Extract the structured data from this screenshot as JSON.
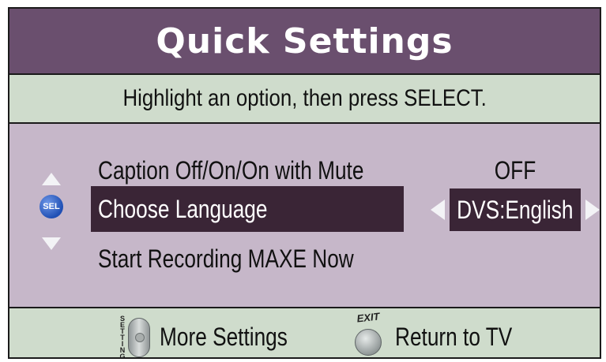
{
  "header": {
    "title": "Quick Settings"
  },
  "instruction": "Highlight an option, then press SELECT.",
  "nav": {
    "up_icon": "triangle-up-icon",
    "select_icon": "select-button-icon",
    "select_label": "SEL",
    "down_icon": "triangle-down-icon"
  },
  "menu": {
    "items": [
      {
        "label": "Caption Off/On/On with Mute",
        "value": "OFF",
        "selected": false
      },
      {
        "label": "Choose Language",
        "value": "DVS:English",
        "selected": true
      },
      {
        "label": "Start Recording MAXE Now",
        "value": "",
        "selected": false
      }
    ]
  },
  "footer": {
    "settings_key_text": "SETTINGS",
    "more_settings_label": "More Settings",
    "exit_key_text": "EXIT",
    "return_label": "Return to TV"
  },
  "colors": {
    "title_bar": "#6a4f6e",
    "instruction_bar": "#cfdccc",
    "menu_background": "#c6b7c9",
    "selected_item": "#3a2536",
    "select_button": "#1f4fb4"
  }
}
